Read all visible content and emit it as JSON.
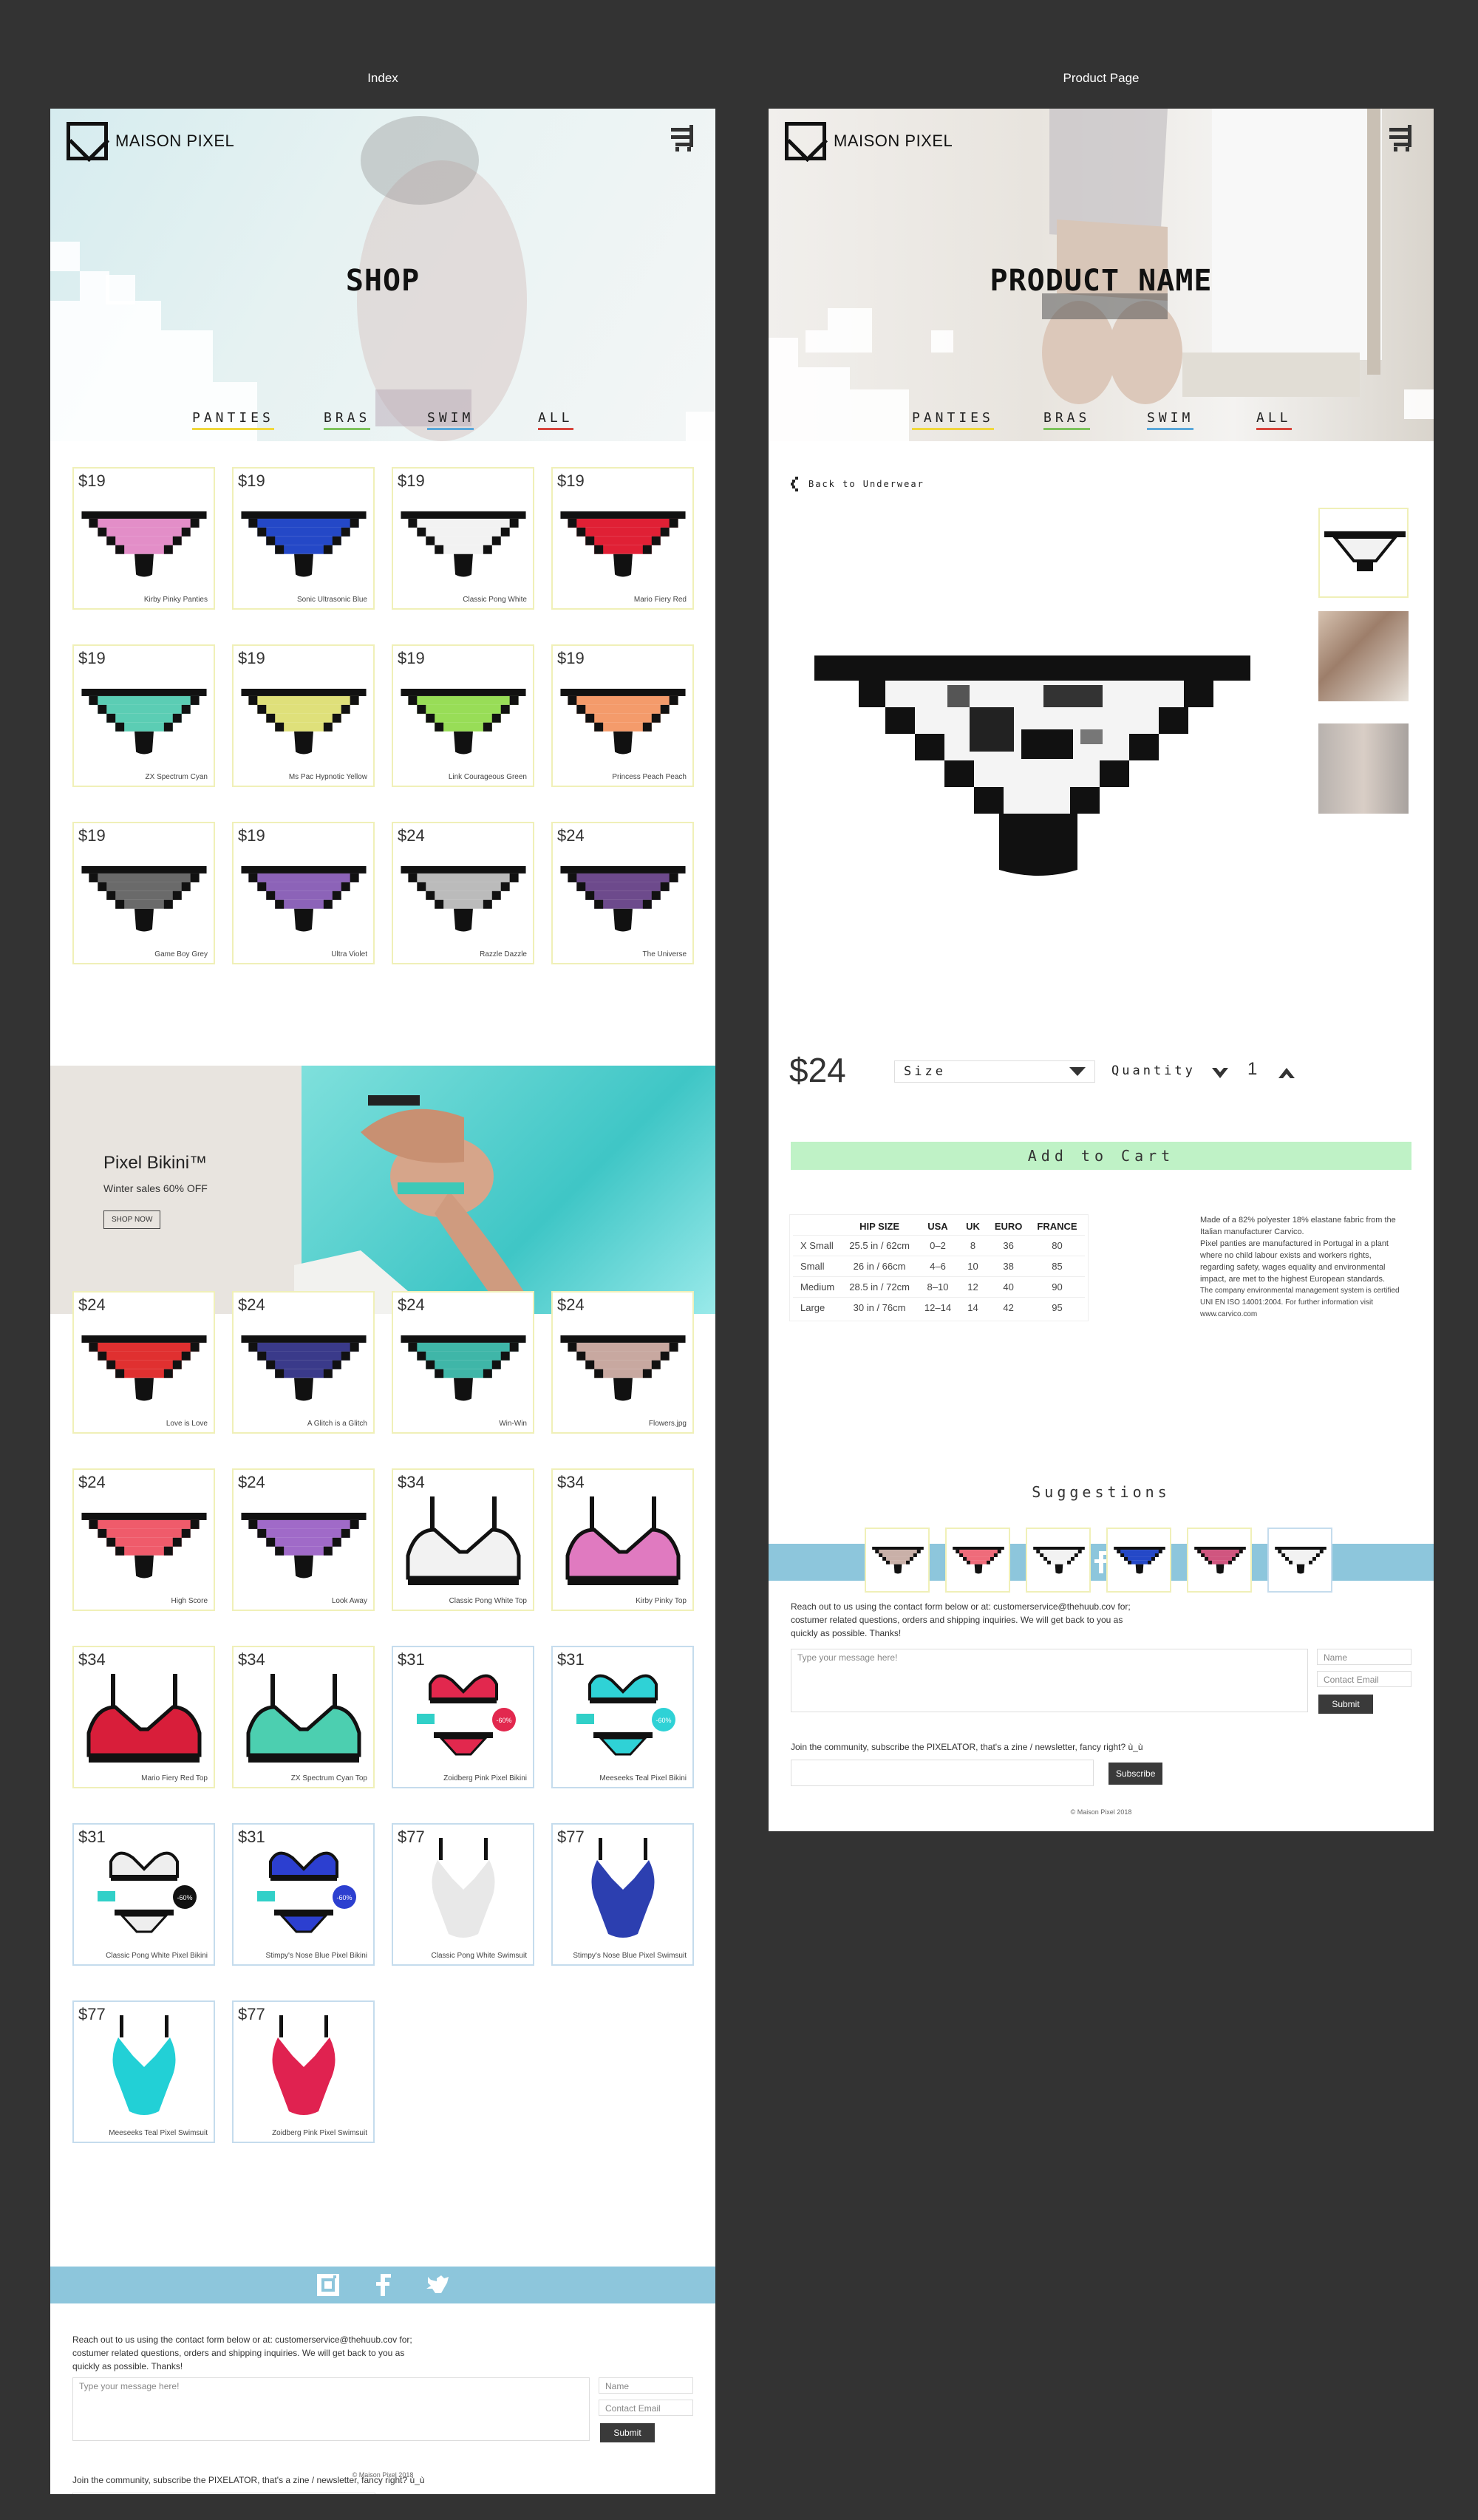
{
  "labels": {
    "index": "Index",
    "product": "Product Page"
  },
  "brand": {
    "name": "MAISON PIXEL"
  },
  "index": {
    "hero_title": "SHOP",
    "nav": [
      {
        "label": "PANTIES",
        "color": "#f0d83c"
      },
      {
        "label": "BRAS",
        "color": "#7cc35b"
      },
      {
        "label": "SWIM",
        "color": "#5aa7d9"
      },
      {
        "label": "ALL",
        "color": "#d7443c"
      }
    ],
    "products_top": [
      {
        "price": "$19",
        "name": "Kirby Pinky Panties",
        "color": "#e38ec8"
      },
      {
        "price": "$19",
        "name": "Sonic  Ultrasonic  Blue",
        "color": "#2448c7"
      },
      {
        "price": "$19",
        "name": "Classic Pong White",
        "color": "#f2f2f2"
      },
      {
        "price": "$19",
        "name": "Mario Fiery Red",
        "color": "#e02035"
      },
      {
        "price": "$19",
        "name": "ZX Spectrum Cyan",
        "color": "#5bcdb4"
      },
      {
        "price": "$19",
        "name": "Ms Pac Hypnotic Yellow",
        "color": "#dfe07a"
      },
      {
        "price": "$19",
        "name": "Link Courageous Green",
        "color": "#98dd57"
      },
      {
        "price": "$19",
        "name": "Princess Peach Peach",
        "color": "#f49b6b"
      },
      {
        "price": "$19",
        "name": "Game Boy Grey",
        "color": "#6a6a6a"
      },
      {
        "price": "$19",
        "name": "Ultra Violet",
        "color": "#8c63b8"
      },
      {
        "price": "$24",
        "name": "Razzle Dazzle",
        "color": "#bbbbbb"
      },
      {
        "price": "$24",
        "name": "The Universe",
        "color": "#6d4a8c"
      }
    ],
    "banner": {
      "title": "Pixel Bikini™",
      "subtitle": "Winter sales 60% OFF",
      "button": "SHOP NOW"
    },
    "products_bottom": [
      {
        "price": "$24",
        "name": "Love is Love",
        "kind": "panty",
        "color": "#e03030"
      },
      {
        "price": "$24",
        "name": "A Glitch is a Glitch",
        "kind": "panty",
        "color": "#3a3a8a"
      },
      {
        "price": "$24",
        "name": "Win-Win",
        "kind": "panty",
        "color": "#3fb6a8"
      },
      {
        "price": "$24",
        "name": "Flowers.jpg",
        "kind": "panty",
        "color": "#c8a8a0"
      },
      {
        "price": "$24",
        "name": "High Score",
        "kind": "panty",
        "color": "#ef5b6b"
      },
      {
        "price": "$24",
        "name": "Look Away",
        "kind": "panty",
        "color": "#a06ac8"
      },
      {
        "price": "$34",
        "name": "Classic Pong White Top",
        "kind": "bra",
        "color": "#f2f2f2"
      },
      {
        "price": "$34",
        "name": "Kirby Pinky Top",
        "kind": "bra",
        "color": "#e07ac0"
      },
      {
        "price": "$34",
        "name": "Mario Fiery Red Top",
        "kind": "bra",
        "color": "#d81e3a"
      },
      {
        "price": "$34",
        "name": "ZX Spectrum Cyan Top",
        "kind": "bra",
        "color": "#4ccfb0"
      },
      {
        "price": "$31",
        "name": "Zoidberg Pink Pixel Bikini",
        "kind": "bikini",
        "color": "#e2284e",
        "badge": "-60%"
      },
      {
        "price": "$31",
        "name": "Meeseeks Teal Pixel Bikini",
        "kind": "bikini",
        "color": "#2fd2d6",
        "badge": "-60%"
      },
      {
        "price": "$31",
        "name": "Classic Pong White Pixel Bikini",
        "kind": "bikini",
        "color": "#eeeeee",
        "badge": "-60%"
      },
      {
        "price": "$31",
        "name": "Stimpy's Nose Blue Pixel Bikini",
        "kind": "bikini",
        "color": "#2c3fd0",
        "badge": "-60%"
      },
      {
        "price": "$77",
        "name": "Classic Pong White Swimsuit",
        "kind": "swimsuit",
        "color": "#e8e8e8"
      },
      {
        "price": "$77",
        "name": "Stimpy's Nose Blue Pixel Swimsuit",
        "kind": "swimsuit",
        "color": "#2c3fb0"
      },
      {
        "price": "$77",
        "name": "Meeseeks Teal Pixel Swimsuit",
        "kind": "swimsuit",
        "color": "#22d0d6"
      },
      {
        "price": "$77",
        "name": "Zoidberg Pink Pixel Swimsuit",
        "kind": "swimsuit",
        "color": "#e02250"
      }
    ]
  },
  "footer": {
    "contact_text_1": "Reach out to us using the contact form below or at: customerservice@thehuub.cov for;",
    "contact_text_2": "costumer related questions, orders and shipping inquiries. We will get back to you as",
    "contact_text_3": "quickly as possible. Thanks!",
    "message_placeholder": "Type your message here!",
    "name_placeholder": "Name",
    "email_placeholder": "Contact Email",
    "submit": "Submit",
    "newsletter_text": "Join the community, subscribe the PIXELATOR, that's a zine / newsletter, fancy right? ù_ù",
    "subscribe": "Subscribe",
    "copyright": "© Maison Pixel 2018"
  },
  "product": {
    "hero_title": "PRODUCT NAME",
    "back": "Back to Underwear",
    "price": "$24",
    "size_label": "Size",
    "quantity_label": "Quantity",
    "quantity": "1",
    "add_to_cart": "Add to Cart",
    "size_table": {
      "headers": [
        "",
        "HIP SIZE",
        "USA",
        "UK",
        "EURO",
        "FRANCE"
      ],
      "rows": [
        [
          "X Small",
          "25.5 in / 62cm",
          "0–2",
          "8",
          "36",
          "80"
        ],
        [
          "Small",
          "26 in / 66cm",
          "4–6",
          "10",
          "38",
          "85"
        ],
        [
          "Medium",
          "28.5 in / 72cm",
          "8–10",
          "12",
          "40",
          "90"
        ],
        [
          "Large",
          "30 in / 76cm",
          "12–14",
          "14",
          "42",
          "95"
        ]
      ]
    },
    "desc_1": "Made of a 82% polyester 18% elastane fabric from the Italian manufacturer Carvico.",
    "desc_2": "Pixel panties are manufactured in Portugal in a plant where no child labour exists and workers rights, regarding safety, wages equality and environmental impact, are met to the highest European standards.",
    "desc_3": "The company environmental management system is certified UNI EN ISO 14001:2004. For further information visit www.carvico.com",
    "suggestions_title": "Suggestions"
  }
}
